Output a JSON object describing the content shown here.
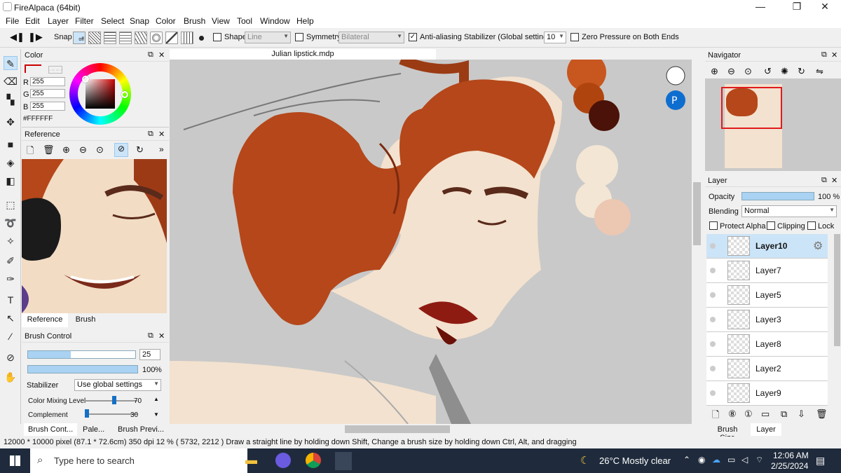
{
  "window": {
    "title": "FireAlpaca (64bit)",
    "minimize": "—",
    "maximize": "❐",
    "close": "✕"
  },
  "menu": [
    "File",
    "Edit",
    "Layer",
    "Filter",
    "Select",
    "Snap",
    "Color",
    "Brush",
    "View",
    "Tool",
    "Window",
    "Help"
  ],
  "toolbar": {
    "snap_label": "Snap",
    "snap_state": "off",
    "shape_label": "Shape",
    "shape_value": "Line",
    "symmetry_label": "Symmetry",
    "symmetry_value": "Bilateral",
    "antialias_label": "Anti-aliasing",
    "antialias_checked": "✓",
    "stabilizer_label": "Stabilizer (Global settings)",
    "stabilizer_value": "10",
    "zero_pressure_label": "Zero Pressure on Both Ends"
  },
  "color_panel": {
    "title": "Color",
    "r_label": "R",
    "r_value": "255",
    "g_label": "G",
    "g_value": "255",
    "b_label": "B",
    "b_value": "255",
    "hex": "#FFFFFF"
  },
  "reference_panel": {
    "title": "Reference",
    "tabs": [
      "Reference",
      "Brush"
    ],
    "more": "»"
  },
  "brush_control": {
    "title": "Brush Control",
    "size_value": "25",
    "size_fraction": 0.4,
    "opacity_value": "100",
    "opacity_unit": "%",
    "opacity_fraction": 1.0,
    "stabilizer_label": "Stabilizer",
    "stabilizer_value": "Use global settings",
    "mixing_label": "Color Mixing Level",
    "mixing_value": "70",
    "complement_label": "Complement",
    "complement_value": "30"
  },
  "bottom_left_tabs": [
    "Brush Cont...",
    "Pale...",
    "Brush Previ..."
  ],
  "document": {
    "tab_title": "Julian lipstick.mdp"
  },
  "navigator": {
    "title": "Navigator"
  },
  "layer_panel": {
    "title": "Layer",
    "opacity_label": "Opacity",
    "opacity_value": "100 %",
    "opacity_fraction": 1.0,
    "blending_label": "Blending",
    "blending_value": "Normal",
    "protect_alpha": "Protect Alpha",
    "clipping": "Clipping",
    "lock": "Lock",
    "layers": [
      {
        "name": "Layer10",
        "selected": true
      },
      {
        "name": "Layer7",
        "selected": false
      },
      {
        "name": "Layer5",
        "selected": false
      },
      {
        "name": "Layer3",
        "selected": false
      },
      {
        "name": "Layer8",
        "selected": false
      },
      {
        "name": "Layer2",
        "selected": false
      },
      {
        "name": "Layer9",
        "selected": false
      }
    ]
  },
  "bottom_right_tabs": [
    "Brush Size",
    "Layer"
  ],
  "status": "12000 * 10000 pixel  (87.1 * 72.6cm)  350 dpi  12 %  ( 5732, 2212 )  Draw a straight line by holding down Shift, Change a brush size by holding down Ctrl, Alt, and dragging",
  "taskbar": {
    "search_placeholder": "Type here to search",
    "weather": "26°C  Mostly clear",
    "time": "12:06 AM",
    "date": "2/25/2024"
  },
  "colors": {
    "accent": "#cce4f7",
    "hair": "#b5471a",
    "skin": "#f3e2cf",
    "lip": "#8e1b12",
    "taskbar": "#1f2b3c"
  }
}
